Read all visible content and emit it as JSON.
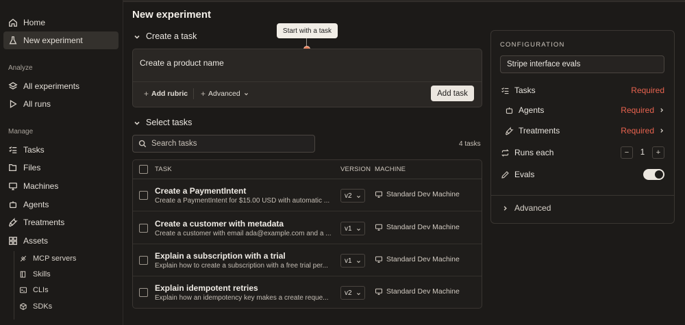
{
  "sidebar": {
    "top_items": [
      {
        "label": "Home",
        "icon": "home-icon"
      },
      {
        "label": "New experiment",
        "icon": "flask-icon"
      }
    ],
    "analyze_label": "Analyze",
    "analyze_items": [
      {
        "label": "All experiments",
        "icon": "layers-icon"
      },
      {
        "label": "All runs",
        "icon": "play-icon"
      }
    ],
    "manage_label": "Manage",
    "manage_items": [
      {
        "label": "Tasks",
        "icon": "list-check-icon"
      },
      {
        "label": "Files",
        "icon": "files-icon"
      },
      {
        "label": "Machines",
        "icon": "monitor-icon"
      },
      {
        "label": "Agents",
        "icon": "bot-icon"
      },
      {
        "label": "Treatments",
        "icon": "wrench-icon"
      },
      {
        "label": "Assets",
        "icon": "grid-icon"
      }
    ],
    "asset_items": [
      {
        "label": "MCP servers",
        "icon": "server-icon"
      },
      {
        "label": "Skills",
        "icon": "book-icon"
      },
      {
        "label": "CLIs",
        "icon": "terminal-icon"
      },
      {
        "label": "SDKs",
        "icon": "package-icon"
      }
    ]
  },
  "main": {
    "title": "New experiment",
    "create_section": "Create a task",
    "tooltip": "Start with a task",
    "create_input": "Create a product name",
    "add_rubric": "Add rubric",
    "advanced": "Advanced",
    "add_task": "Add task",
    "select_section": "Select tasks",
    "search_placeholder": "Search tasks",
    "task_count": "4 tasks",
    "columns": {
      "task": "TASK",
      "version": "VERSION",
      "machine": "MACHINE"
    },
    "tasks": [
      {
        "title": "Create a PaymentIntent",
        "desc": "Create a PaymentIntent for $15.00 USD with automatic ...",
        "version": "v2",
        "machine": "Standard Dev Machine"
      },
      {
        "title": "Create a customer with metadata",
        "desc": "Create a customer with email ada@example.com and a ...",
        "version": "v1",
        "machine": "Standard Dev Machine"
      },
      {
        "title": "Explain a subscription with a trial",
        "desc": "Explain how to create a subscription with a free trial per...",
        "version": "v1",
        "machine": "Standard Dev Machine"
      },
      {
        "title": "Explain idempotent retries",
        "desc": "Explain how an idempotency key makes a create reque...",
        "version": "v2",
        "machine": "Standard Dev Machine"
      }
    ]
  },
  "config": {
    "label": "CONFIGURATION",
    "name": "Stripe interface evals",
    "tasks_label": "Tasks",
    "tasks_status": "Required",
    "agents_label": "Agents",
    "agents_status": "Required",
    "treatments_label": "Treatments",
    "treatments_status": "Required",
    "runs_label": "Runs each",
    "runs_value": "1",
    "minus": "−",
    "plus": "+",
    "evals_label": "Evals",
    "evals_enabled": true,
    "advanced": "Advanced",
    "colors": {
      "required": "#e8634f",
      "accent_dot": "#e77e5a"
    }
  }
}
